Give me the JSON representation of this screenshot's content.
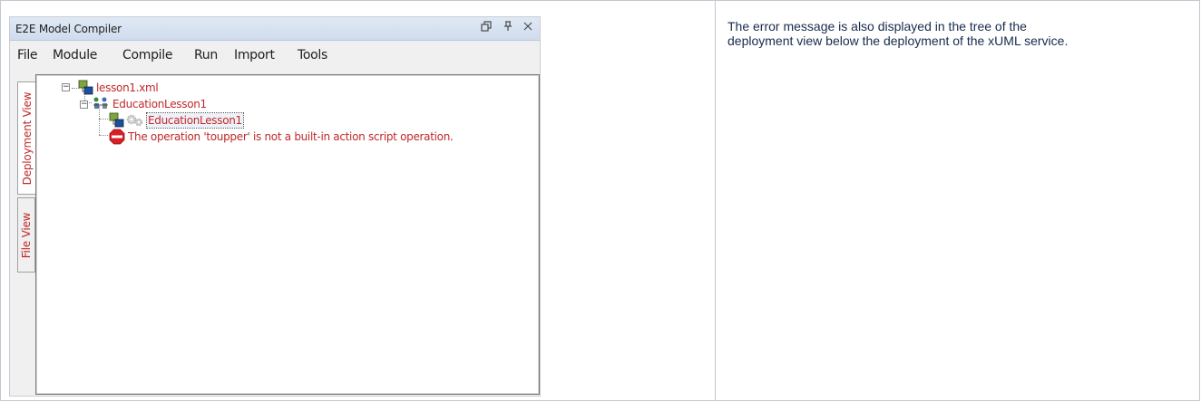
{
  "window": {
    "title": "E2E Model Compiler",
    "buttons": {
      "restore": "⧉",
      "pin": "⊥",
      "close": "✕"
    }
  },
  "menu": [
    "File",
    "Module",
    "Compile",
    "Run",
    "Import",
    "Tools"
  ],
  "side_tabs": {
    "deployment": "Deployment View",
    "file": "File View"
  },
  "tree": {
    "root": "lesson1.xml",
    "service": "EducationLesson1",
    "deployment": "EducationLesson1",
    "error": "The operation 'toupper' is not a built-in action script operation."
  },
  "description": "The error message is also displayed in the tree of the deployment view below the deployment of the xUML service.",
  "colors": {
    "tree_text": "#c0282a",
    "title_gradient": "#cfdced",
    "error_icon": "#d91f26"
  },
  "icons": [
    "collapse-icon",
    "xml-file-icon",
    "service-icon",
    "deployment-icon",
    "gear-icon",
    "stop-error-icon"
  ]
}
